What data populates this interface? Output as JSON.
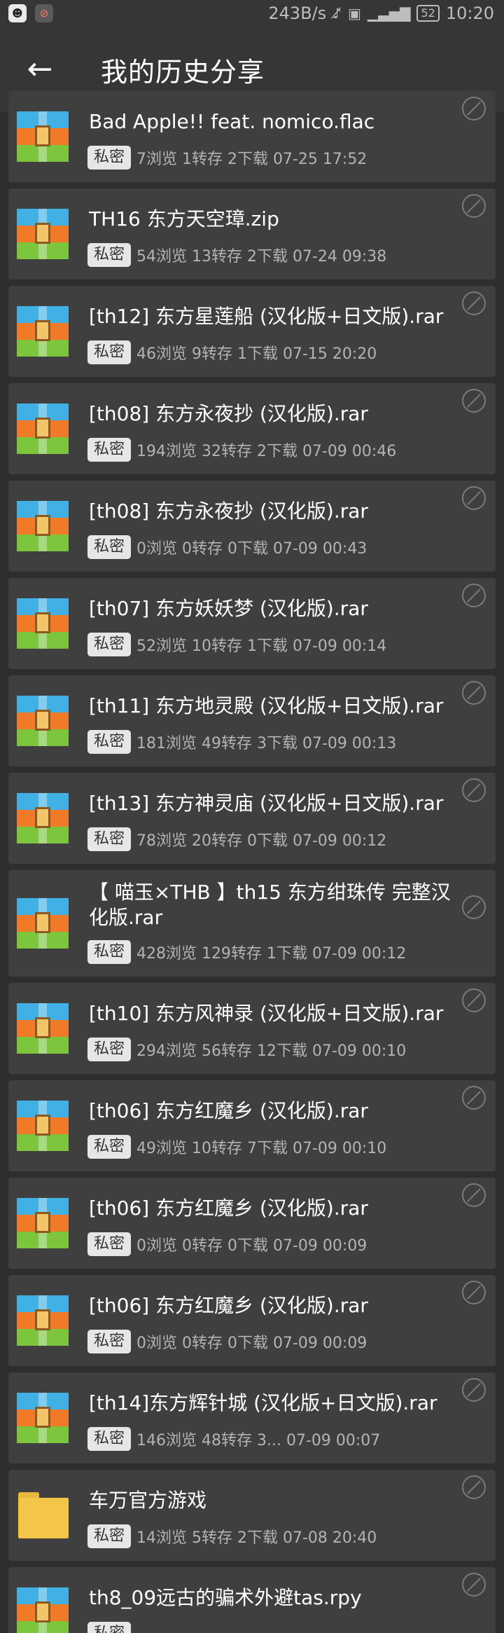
{
  "status_bar": {
    "left_apps": [
      "qq-icon",
      "blocked-app-icon"
    ],
    "net_speed": "243B/s",
    "battery": "52",
    "time": "10:20"
  },
  "header": {
    "back_icon": "arrow-left-icon",
    "title": "我的历史分享"
  },
  "colors": {
    "background": "#2e2e2e",
    "card": "#3f3f3f",
    "header": "#363636",
    "badge_bg": "#e6e6e6",
    "meta_text": "#b4b4b4"
  },
  "shares": [
    {
      "icon": "archive-icon",
      "name": "Bad Apple!! feat. nomico.flac",
      "badge": "私密",
      "meta": "7浏览 1转存 2下载 07-25 17:52"
    },
    {
      "icon": "archive-icon",
      "name": "TH16 东方天空璋.zip",
      "badge": "私密",
      "meta": "54浏览 13转存 2下载 07-24 09:38"
    },
    {
      "icon": "archive-icon",
      "name": "[th12] 东方星莲船 (汉化版+日文版).rar",
      "badge": "私密",
      "meta": "46浏览 9转存 1下载 07-15 20:20"
    },
    {
      "icon": "archive-icon",
      "name": "[th08] 东方永夜抄 (汉化版).rar",
      "badge": "私密",
      "meta": "194浏览 32转存 2下载 07-09 00:46"
    },
    {
      "icon": "archive-icon",
      "name": "[th08] 东方永夜抄 (汉化版).rar",
      "badge": "私密",
      "meta": "0浏览 0转存 0下载 07-09 00:43"
    },
    {
      "icon": "archive-icon",
      "name": "[th07] 东方妖妖梦 (汉化版).rar",
      "badge": "私密",
      "meta": "52浏览 10转存 1下载 07-09 00:14"
    },
    {
      "icon": "archive-icon",
      "name": "[th11] 东方地灵殿 (汉化版+日文版).rar",
      "badge": "私密",
      "meta": "181浏览 49转存 3下载 07-09 00:13"
    },
    {
      "icon": "archive-icon",
      "name": "[th13] 东方神灵庙 (汉化版+日文版).rar",
      "badge": "私密",
      "meta": "78浏览 20转存 0下载 07-09 00:12"
    },
    {
      "icon": "archive-icon",
      "name": "【 喵玉×THB 】th15 东方绀珠传 完整汉化版.rar",
      "badge": "私密",
      "meta": "428浏览 129转存 1下载 07-09 00:12"
    },
    {
      "icon": "archive-icon",
      "name": "[th10] 东方风神录 (汉化版+日文版).rar",
      "badge": "私密",
      "meta": "294浏览 56转存 12下载 07-09 00:10"
    },
    {
      "icon": "archive-icon",
      "name": "[th06] 东方红魔乡 (汉化版).rar",
      "badge": "私密",
      "meta": "49浏览 10转存 7下载 07-09 00:10"
    },
    {
      "icon": "archive-icon",
      "name": "[th06] 东方红魔乡 (汉化版).rar",
      "badge": "私密",
      "meta": "0浏览 0转存 0下载 07-09 00:09"
    },
    {
      "icon": "archive-icon",
      "name": "[th06] 东方红魔乡 (汉化版).rar",
      "badge": "私密",
      "meta": "0浏览 0转存 0下载 07-09 00:09"
    },
    {
      "icon": "archive-icon",
      "name": "[th14]东方辉针城 (汉化版+日文版).rar",
      "badge": "私密",
      "meta": "146浏览 48转存 3...    07-09 00:07"
    },
    {
      "icon": "folder-icon",
      "name": "车万官方游戏",
      "badge": "私密",
      "meta": "14浏览 5转存 2下载 07-08 20:40"
    },
    {
      "icon": "archive-icon",
      "name": "th8_09远古的骗术外避tas.rpy",
      "badge": "私密",
      "meta": ""
    }
  ]
}
